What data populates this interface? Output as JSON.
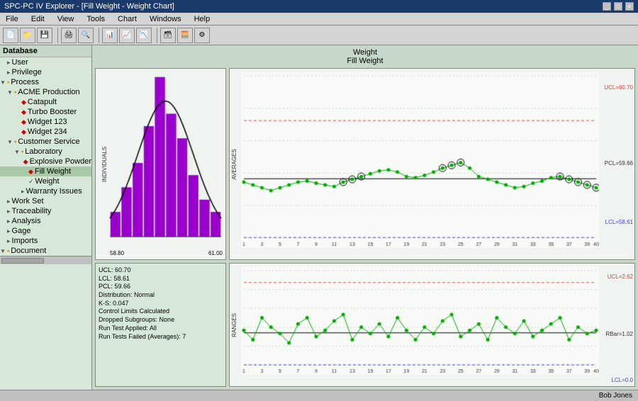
{
  "window": {
    "title": "SPC-PC IV Explorer - [Fill Weight - Weight Chart]",
    "controls": [
      "_",
      "□",
      "×"
    ]
  },
  "menu": {
    "items": [
      "File",
      "Edit",
      "View",
      "Tools",
      "Chart",
      "Windows",
      "Help"
    ]
  },
  "chart_title": {
    "line1": "Weight",
    "line2": "Fill Weight"
  },
  "sidebar": {
    "header": "Database",
    "tree": [
      {
        "label": "User",
        "indent": 1,
        "icon": "leaf",
        "type": "item"
      },
      {
        "label": "Privilege",
        "indent": 1,
        "icon": "leaf",
        "type": "item"
      },
      {
        "label": "Process",
        "indent": 1,
        "icon": "folder",
        "type": "folder"
      },
      {
        "label": "ACME Production",
        "indent": 2,
        "icon": "folder",
        "type": "folder"
      },
      {
        "label": "Catapult",
        "indent": 3,
        "icon": "diamond",
        "type": "item"
      },
      {
        "label": "Turbo Booster",
        "indent": 3,
        "icon": "diamond",
        "type": "item"
      },
      {
        "label": "Widget 123",
        "indent": 3,
        "icon": "diamond",
        "type": "item"
      },
      {
        "label": "Widget 234",
        "indent": 3,
        "icon": "diamond",
        "type": "item"
      },
      {
        "label": "Customer Service",
        "indent": 2,
        "icon": "folder",
        "type": "folder"
      },
      {
        "label": "Laboratory",
        "indent": 3,
        "icon": "folder",
        "type": "folder"
      },
      {
        "label": "Explosive Powder",
        "indent": 4,
        "icon": "diamond",
        "type": "item"
      },
      {
        "label": "Fill Weight",
        "indent": 4,
        "icon": "diamond",
        "type": "item",
        "selected": true
      },
      {
        "label": "Weight",
        "indent": 4,
        "icon": "check",
        "type": "item"
      },
      {
        "label": "Warranty Issues",
        "indent": 3,
        "icon": "leaf",
        "type": "item"
      },
      {
        "label": "Work Set",
        "indent": 1,
        "icon": "leaf",
        "type": "item"
      },
      {
        "label": "Traceability",
        "indent": 1,
        "icon": "leaf",
        "type": "item"
      },
      {
        "label": "Analysis",
        "indent": 1,
        "icon": "leaf",
        "type": "item"
      },
      {
        "label": "Gage",
        "indent": 1,
        "icon": "leaf",
        "type": "item"
      },
      {
        "label": "Imports",
        "indent": 1,
        "icon": "leaf",
        "type": "item"
      },
      {
        "label": "Document",
        "indent": 1,
        "icon": "folder",
        "type": "folder"
      }
    ]
  },
  "averages_chart": {
    "y_axis_label": "AVERAGES",
    "ucl_label": "UCL=60.70",
    "lcl_label": "LCL=58.61",
    "pcl_label": "PCL=59.66",
    "ucl_value": 60.7,
    "lcl_value": 58.61,
    "pcl_value": 59.66,
    "y_max": 61.5,
    "y_min": 58.6,
    "data_points": [
      59.6,
      59.55,
      59.5,
      59.45,
      59.5,
      59.55,
      59.6,
      59.62,
      59.58,
      59.55,
      59.52,
      59.6,
      59.65,
      59.7,
      59.75,
      59.8,
      59.82,
      59.78,
      59.7,
      59.68,
      59.72,
      59.78,
      59.85,
      59.9,
      59.95,
      59.85,
      59.7,
      59.65,
      59.6,
      59.55,
      59.5,
      59.52,
      59.58,
      59.62,
      59.68,
      59.7,
      59.65,
      59.6,
      59.55,
      59.5
    ]
  },
  "ranges_chart": {
    "y_axis_label": "RANGES",
    "ucl_label": "UCL=2.62",
    "lcl_label": "LCL=0.0",
    "rbar_label": "RBar=1.02",
    "ucl_value": 2.62,
    "lcl_value": 0.0,
    "rbar_value": 1.02,
    "y_max": 3.0,
    "y_min": 0.0,
    "data_points": [
      1.1,
      0.8,
      1.5,
      1.2,
      1.0,
      0.7,
      1.3,
      1.5,
      0.9,
      1.1,
      1.4,
      1.6,
      0.8,
      1.2,
      1.0,
      1.3,
      0.9,
      1.5,
      1.1,
      0.8,
      1.2,
      1.0,
      1.4,
      1.6,
      0.9,
      1.1,
      1.3,
      0.8,
      1.5,
      1.2,
      1.0,
      1.4,
      0.9,
      1.1,
      1.3,
      1.5,
      0.8,
      1.2,
      1.0,
      1.1
    ]
  },
  "histogram": {
    "title": "INDIVIDUALS",
    "x_min": "58.80",
    "x_max": "61.00",
    "bars": [
      2,
      4,
      6,
      9,
      13,
      10,
      8,
      5,
      3,
      2
    ]
  },
  "stats": {
    "lines": [
      "UCL: 60.70",
      "LCL: 58.61",
      "PCL: 59.66",
      "Distribution: Normal",
      "K-S: 0.047",
      "Control Limits Calculated",
      "Dropped Subgroups: None",
      "Run Test Applied: All",
      "Run Tests Failed (Averages): 7"
    ]
  },
  "status_bar": {
    "user": "Bob Jones"
  },
  "colors": {
    "ucl_line": "#ff6666",
    "lcl_line": "#6666ff",
    "pcl_line": "#000000",
    "data_line": "#00aa00",
    "data_point": "#00aa00",
    "histogram_bar": "#9900cc",
    "chart_bg": "#f8faf8",
    "sidebar_bg": "#d8e8d8",
    "selected_node": "#a8c8a8"
  }
}
